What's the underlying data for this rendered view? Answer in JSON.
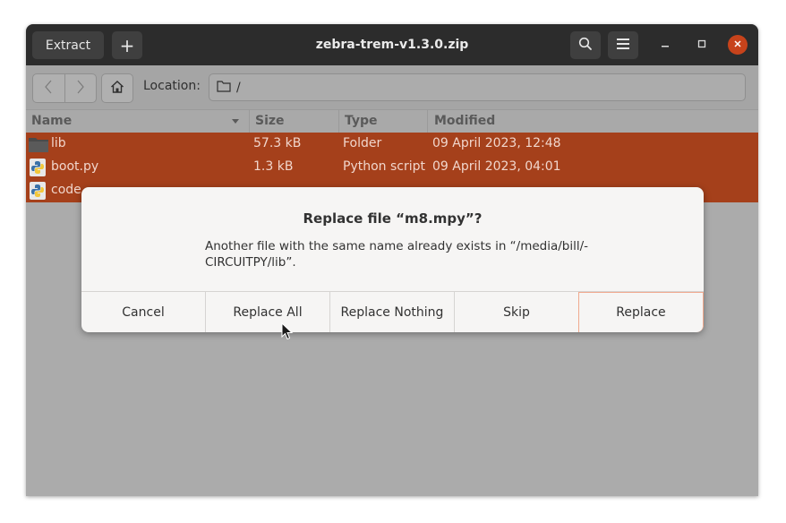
{
  "window": {
    "title": "zebra-trem-v1.3.0.zip",
    "extract_label": "Extract",
    "add_label": "+",
    "icons": [
      "search-icon",
      "menu-icon",
      "minimize-icon",
      "maximize-icon",
      "close-icon"
    ],
    "close_color": "#c7431b"
  },
  "toolbar": {
    "location_label": "Location:",
    "location_path": "/"
  },
  "columns": [
    "Name",
    "Size",
    "Type",
    "Modified"
  ],
  "files": [
    {
      "name": "lib",
      "size": "57.3 kB",
      "type": "Folder",
      "modified": "09 April 2023, 12:48",
      "icon": "folder-icon"
    },
    {
      "name": "boot.py",
      "size": "1.3 kB",
      "type": "Python script",
      "modified": "09 April 2023, 04:01",
      "icon": "python-file-icon"
    },
    {
      "name": "code",
      "size": "",
      "type": "",
      "modified": "",
      "icon": "python-file-icon"
    }
  ],
  "selection_color": "#a5401b",
  "dialog": {
    "title": "Replace file “m8.mpy”?",
    "message": "Another file with the same name already exists in “/media/bill/-CIRCUITPY/lib”.",
    "buttons": {
      "cancel": "Cancel",
      "replace_all": "Replace All",
      "replace_nothing": "Replace Nothing",
      "skip": "Skip",
      "replace": "Replace"
    }
  }
}
